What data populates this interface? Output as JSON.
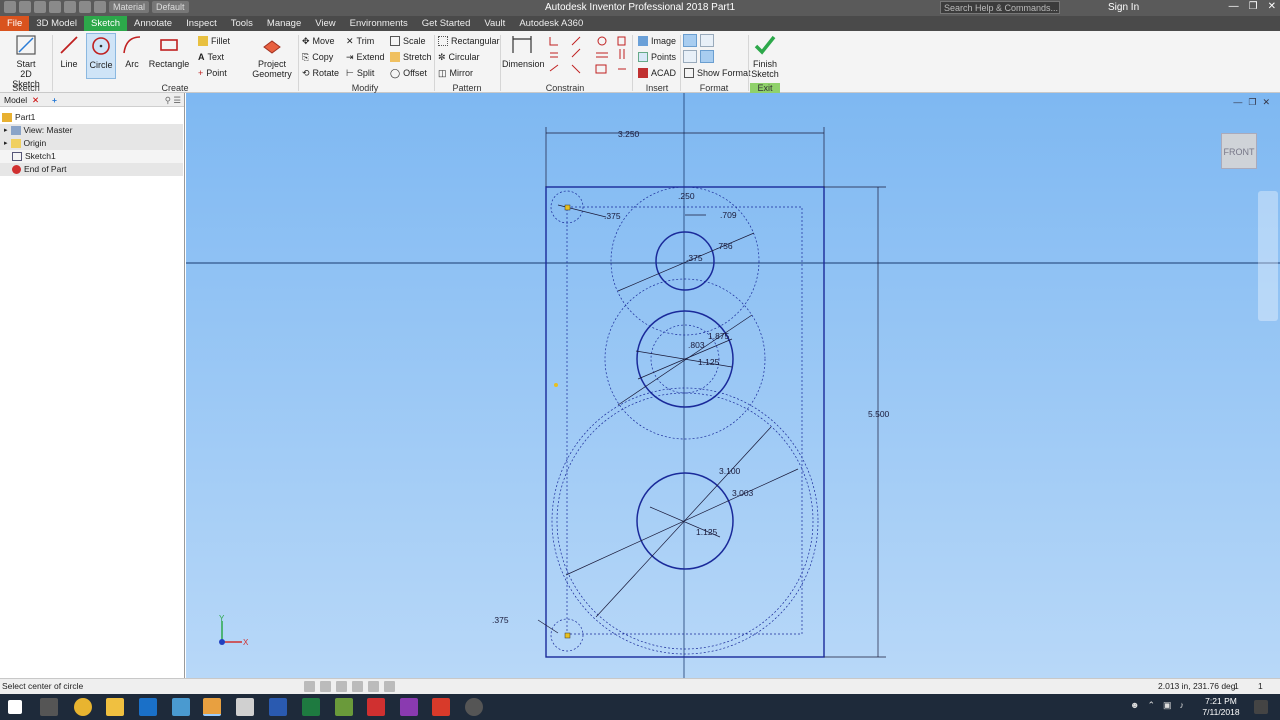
{
  "window": {
    "title": "Autodesk Inventor Professional 2018   Part1",
    "search_placeholder": "Search Help & Commands...",
    "sign_in": "Sign In",
    "material": "Material",
    "appearance": "Default"
  },
  "tabs": [
    "File",
    "3D Model",
    "Sketch",
    "Annotate",
    "Inspect",
    "Tools",
    "Manage",
    "View",
    "Environments",
    "Get Started",
    "Vault",
    "Autodesk A360"
  ],
  "active_tab": "Sketch",
  "ribbon": {
    "sketch": {
      "start_2d_sketch": "Start\n2D Sketch",
      "label": "Sketch"
    },
    "create": {
      "line": "Line",
      "circle": "Circle",
      "arc": "Arc",
      "rectangle": "Rectangle",
      "fillet": "Fillet",
      "text": "Text",
      "point": "Point",
      "project_geometry": "Project\nGeometry",
      "label": "Create"
    },
    "modify": {
      "move": "Move",
      "trim": "Trim",
      "scale": "Scale",
      "copy": "Copy",
      "extend": "Extend",
      "stretch": "Stretch",
      "rotate": "Rotate",
      "split": "Split",
      "offset": "Offset",
      "label": "Modify"
    },
    "pattern": {
      "rectangular": "Rectangular",
      "circular": "Circular",
      "mirror": "Mirror",
      "label": "Pattern"
    },
    "dimension": "Dimension",
    "constrain_label": "Constrain",
    "insert": {
      "image": "Image",
      "points": "Points",
      "acad": "ACAD",
      "label": "Insert"
    },
    "format": {
      "show_format": "Show Format",
      "label": "Format"
    },
    "exit": {
      "finish_sketch": "Finish\nSketch",
      "label": "Exit"
    }
  },
  "browser": {
    "tab": "Model",
    "items": [
      "Part1",
      "View: Master",
      "Origin",
      "Sketch1",
      "End of Part"
    ]
  },
  "sketch": {
    "dims": {
      "width": "3.250",
      "height": "5.500",
      "corner_top": ".375",
      "corner_bottom": ".375",
      "d250": ".250",
      "d709": ".709",
      "d756": ".756",
      "d375": ".375",
      "d1875": "1.875",
      "d803": ".803",
      "d1125a": "1.125",
      "d3100": "3.100",
      "d3003": "3.003",
      "d1125b": "1.125"
    },
    "viewcube_label": "FRONT",
    "triad_x": "X",
    "triad_y": "Y"
  },
  "status": {
    "message": "Select center of circle",
    "coords": "2.013 in, 231.76 deg",
    "count1": "1",
    "count2": "1"
  },
  "taskbar": {
    "time": "7:21 PM",
    "date": "7/11/2018"
  },
  "colors": {
    "accent_green": "#2ca84a",
    "file_orange": "#d9531e",
    "sketch_blue": "#1a2a9a",
    "canvas_top": "#7eb8f2"
  }
}
